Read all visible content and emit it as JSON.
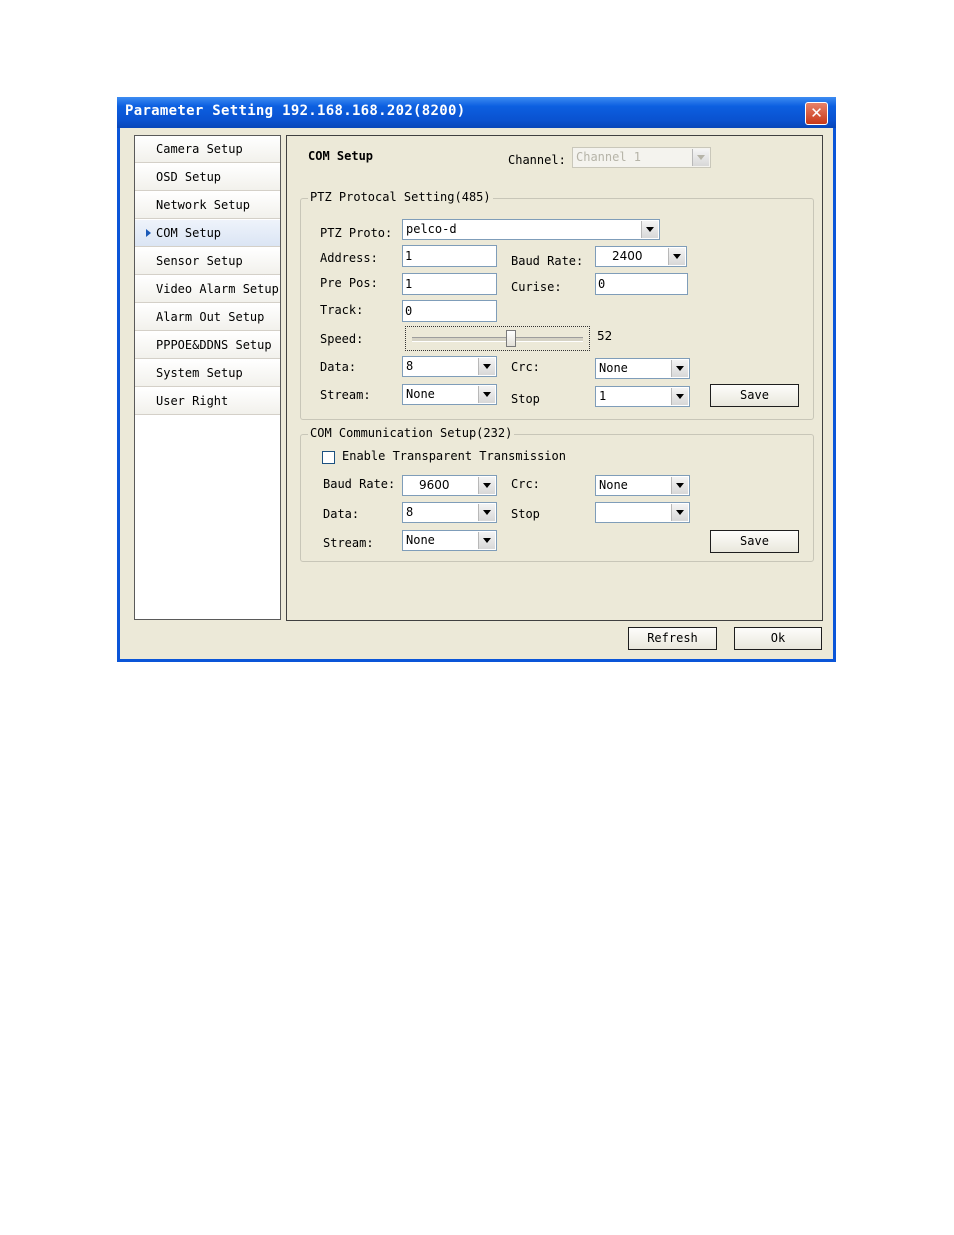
{
  "window": {
    "title": "Parameter Setting 192.168.168.202(8200)"
  },
  "sidebar": {
    "items": [
      {
        "label": "Camera Setup"
      },
      {
        "label": "OSD Setup"
      },
      {
        "label": "Network Setup"
      },
      {
        "label": "COM Setup"
      },
      {
        "label": "Sensor Setup"
      },
      {
        "label": "Video Alarm Setup"
      },
      {
        "label": "Alarm Out Setup"
      },
      {
        "label": "PPPOE&DDNS Setup"
      },
      {
        "label": "System Setup"
      },
      {
        "label": "User Right"
      }
    ],
    "active": "COM Setup"
  },
  "header": {
    "title": "COM Setup",
    "channel_label": "Channel:",
    "channel_value": "Channel 1"
  },
  "ptz": {
    "legend": "PTZ Protocal Setting(485)",
    "proto_label": "PTZ Proto:",
    "proto_value": "pelco-d",
    "address_label": "Address:",
    "address_value": "1",
    "baud_label": "Baud Rate:",
    "baud_value": "2400",
    "prepos_label": "Pre Pos:",
    "prepos_value": "1",
    "curise_label": "Curise:",
    "curise_value": "0",
    "track_label": "Track:",
    "track_value": "0",
    "speed_label": "Speed:",
    "speed_value": "52",
    "speed_fraction": 0.52,
    "data_label": "Data:",
    "data_value": "8",
    "crc_label": "Crc:",
    "crc_value": "None",
    "stream_label": "Stream:",
    "stream_value": "None",
    "stop_label": "Stop",
    "stop_value": "1",
    "save_label": "Save"
  },
  "com": {
    "legend": "COM Communication Setup(232)",
    "transparent_label": "Enable Transparent Transmission",
    "baud_label": "Baud Rate:",
    "baud_value": "9600",
    "crc_label": "Crc:",
    "crc_value": "None",
    "data_label": "Data:",
    "data_value": "8",
    "stop_label": "Stop",
    "stop_value": "",
    "stream_label": "Stream:",
    "stream_value": "None",
    "save_label": "Save"
  },
  "footer": {
    "refresh_label": "Refresh",
    "ok_label": "Ok"
  }
}
